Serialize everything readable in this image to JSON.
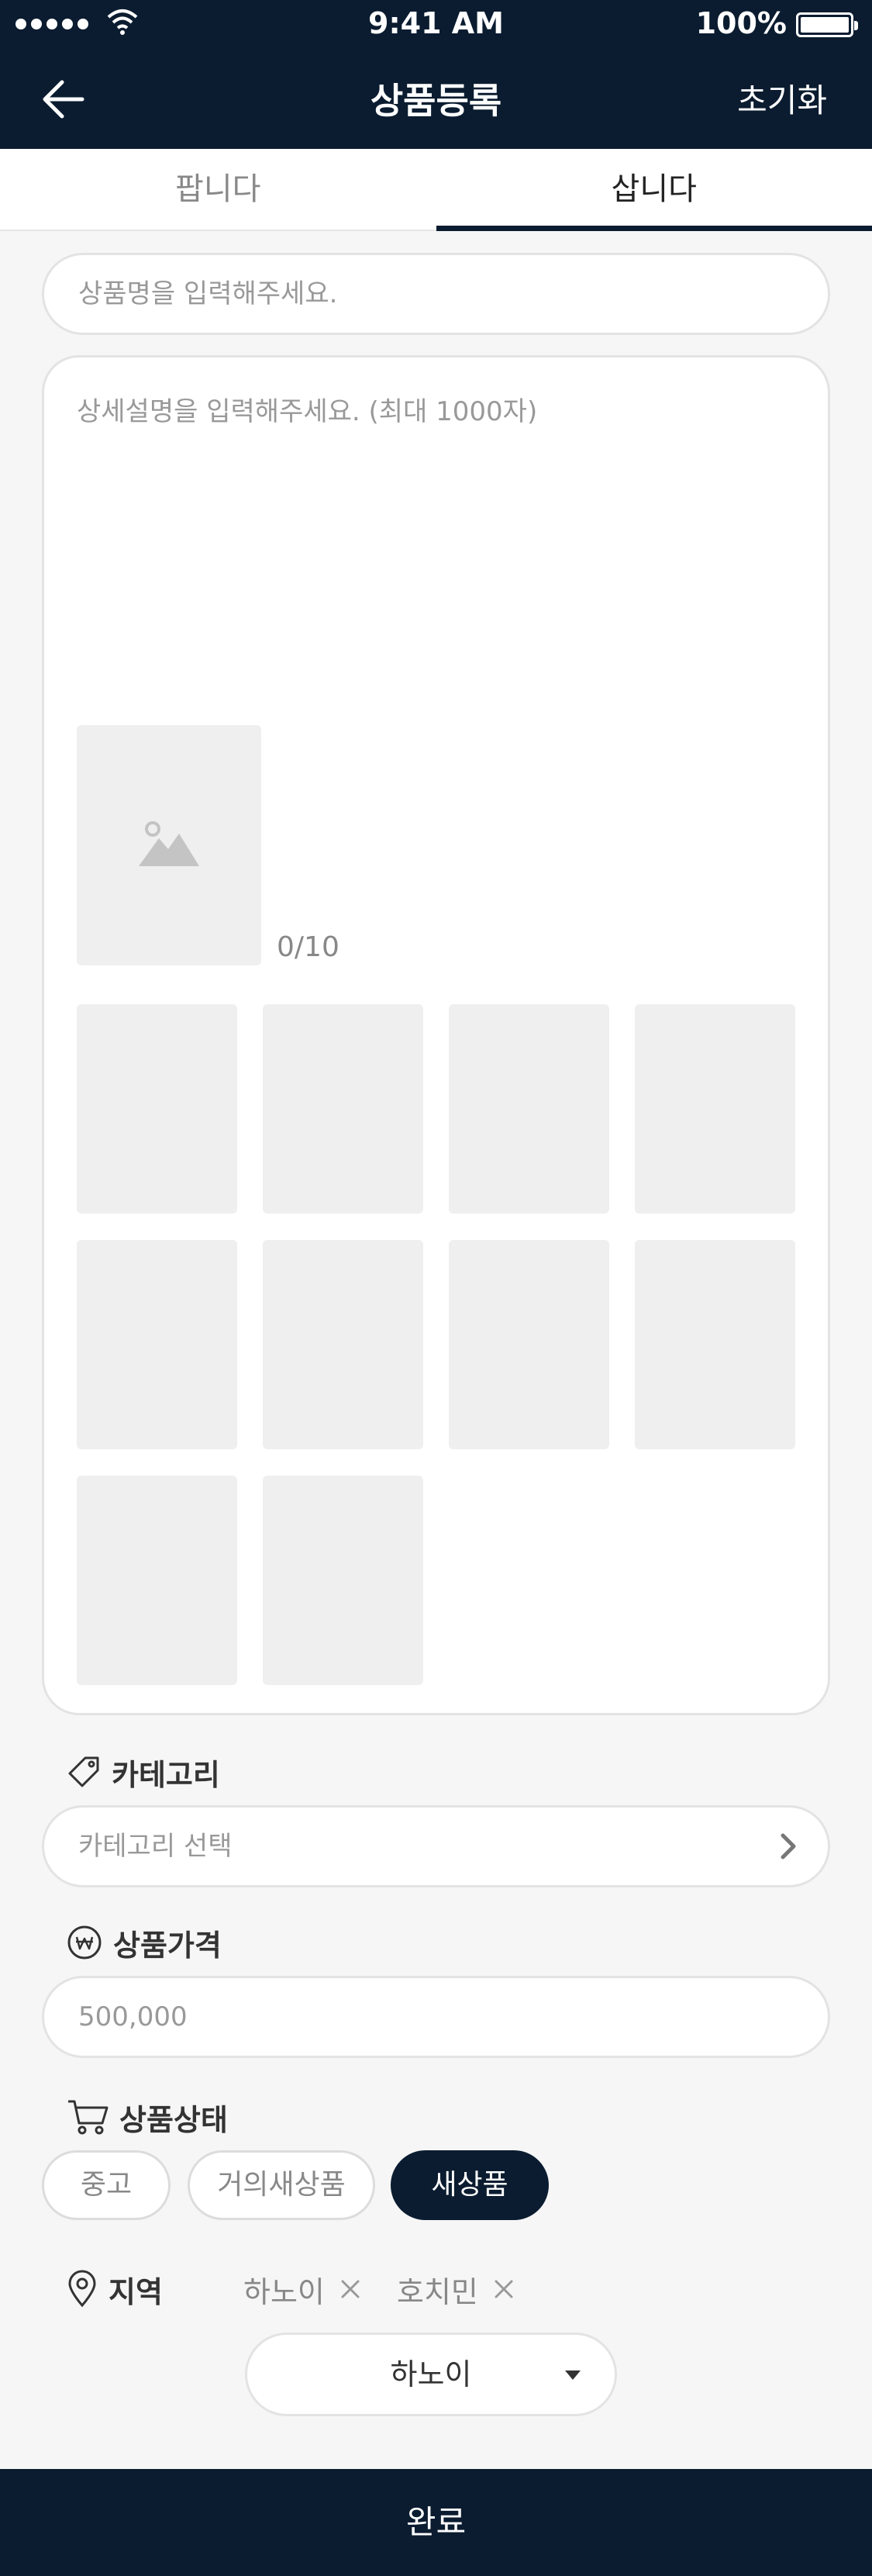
{
  "status_bar": {
    "time": "9:41 AM",
    "battery": "100%"
  },
  "nav": {
    "title": "상품등록",
    "reset_label": "초기화"
  },
  "tabs": [
    {
      "label": "팝니다",
      "active": false
    },
    {
      "label": "삽니다",
      "active": true
    }
  ],
  "form": {
    "product_name_placeholder": "상품명을 입력해주세요.",
    "description_placeholder": "상세설명을 입력해주세요. (최대 1000자)",
    "photo_count": "0/10",
    "category": {
      "label": "카테고리",
      "placeholder": "카테고리 선택"
    },
    "price": {
      "label": "상품가격",
      "value": "500,000"
    },
    "condition": {
      "label": "상품상태",
      "options": [
        "중고",
        "거의새상품",
        "새상품"
      ],
      "selected": "새상품"
    },
    "region": {
      "label": "지역",
      "tags": [
        "하노이",
        "호치민"
      ],
      "dropdown_value": "하노이"
    }
  },
  "submit_label": "완료",
  "colors": {
    "navy": "#0b1c30",
    "background": "#f6f6f6",
    "thumb": "#efefef"
  }
}
